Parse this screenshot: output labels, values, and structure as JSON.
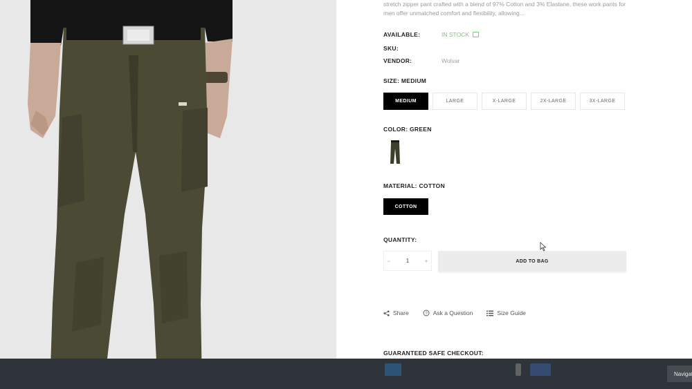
{
  "product": {
    "description": "stretch zipper pant crafted with a blend of 97% Cotton and 3% Elastane, these work pants for men offer unmatched comfort and flexibility, allowing...",
    "available_label": "AVAILABLE:",
    "available_value": "IN STOCK",
    "sku_label": "SKU:",
    "vendor_label": "VENDOR:",
    "vendor_value": "Wolvar",
    "image_icon": "olive-green-cargo-pants-photo"
  },
  "size": {
    "label": "SIZE: MEDIUM",
    "options": [
      "MEDIUM",
      "LARGE",
      "X-LARGE",
      "2X-LARGE",
      "3X-LARGE"
    ],
    "selected": "MEDIUM"
  },
  "color": {
    "label": "COLOR: GREEN",
    "swatch_color": "#3e3f2a"
  },
  "material": {
    "label": "MATERIAL: COTTON",
    "option": "COTTON"
  },
  "quantity": {
    "label": "QUANTITY:",
    "value": "1",
    "minus": "−",
    "plus": "+"
  },
  "add_to_bag": "ADD TO BAG",
  "links": {
    "share": "Share",
    "ask": "Ask a Question",
    "size_guide": "Size Guide"
  },
  "checkout_label": "GUARANTEED SAFE CHECKOUT:",
  "bottom_bar": {
    "nav_button": "Navigation"
  },
  "colors": {
    "accent_black": "#000000",
    "in_stock_green": "#7cc77c",
    "pants_olive": "#4a4a33",
    "bottom_bar": "#2f343a"
  }
}
